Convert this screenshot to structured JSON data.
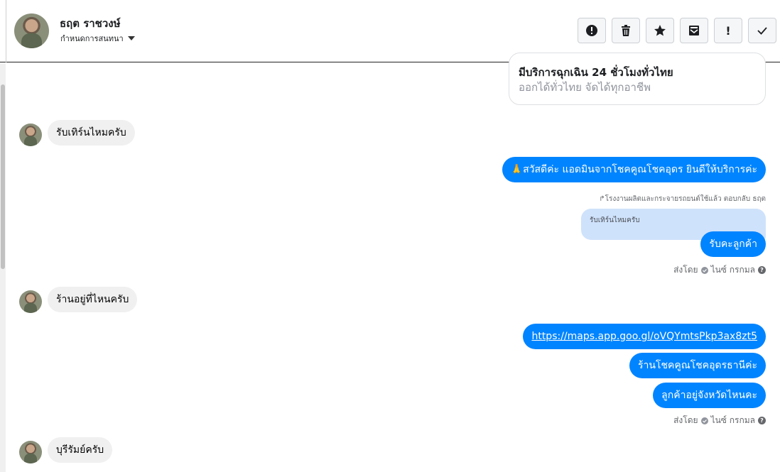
{
  "header": {
    "contact_name": "ธฤต ราชวงษ์",
    "assign_label": "กำหนดการสนทนา",
    "toolbar": [
      {
        "icon": "alert-circle-icon"
      },
      {
        "icon": "trash-icon"
      },
      {
        "icon": "star-icon"
      },
      {
        "icon": "mail-icon"
      },
      {
        "icon": "exclamation-icon",
        "glyph": "!"
      },
      {
        "icon": "check-icon"
      }
    ]
  },
  "conversation": {
    "card": {
      "title": "มีบริการฉุกเฉิน 24 ชั่วโมงทั่วไทย",
      "subtitle": "ออกได้ทั่วไทย จัดได้ทุกอาชีพ"
    },
    "msg1": "รับเทิร์นไหมครับ",
    "msg2": "🙏สวัสดีค่ะ แอดมินจากโชคคูณโชคอุดร ยินดีให้บริการค่ะ",
    "reply_note": "↱โรงงานผลิตและกระจายรถยนต์ใช้แล้ว ตอบกลับ ธฤต",
    "quoted": "รับเทิร์นไหมครับ",
    "msg3": "รับคะลูกค้า",
    "sent_by_1": {
      "prefix": "ส่งโดย",
      "name": "ไนซ์ กรกมล"
    },
    "msg4": "ร้านอยู่ที่ไหนครับ",
    "msg5_link": "https://maps.app.goo.gl/oVQYmtsPkp3ax8zt5",
    "msg6": "ร้านโชคคูณโชคอุดรธานีค่ะ",
    "msg7": "ลูกค้าอยู่จังหวัดไหนคะ",
    "sent_by_2": {
      "prefix": "ส่งโดย",
      "name": "ไนซ์ กรกมล"
    },
    "msg8": "บุรีรัมย์ครับ"
  },
  "colors": {
    "outgoing_bubble": "#0084ff",
    "incoming_bubble": "#f0f0f0",
    "quoted_bubble": "#cfe2fb"
  }
}
